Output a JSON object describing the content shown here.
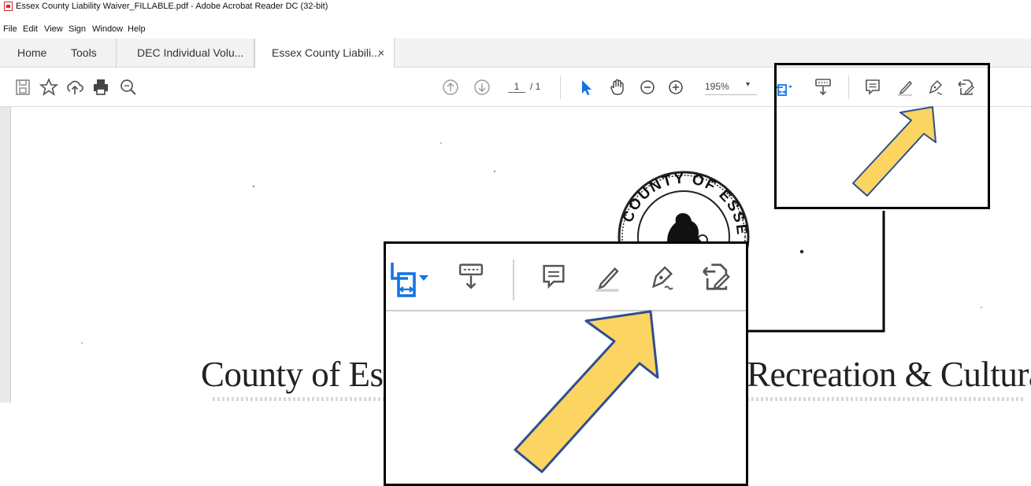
{
  "window": {
    "title": "Essex County Liability Waiver_FILLABLE.pdf - Adobe Acrobat Reader DC (32-bit)"
  },
  "menu": [
    "File",
    "Edit",
    "View",
    "Sign",
    "Window",
    "Help"
  ],
  "tabs": {
    "home": "Home",
    "tools": "Tools",
    "doc1": "DEC Individual Volu...",
    "doc2": "Essex County Liabili...",
    "close_glyph": "×"
  },
  "toolbar": {
    "page_current": "1",
    "page_total": "/ 1",
    "zoom": "195%",
    "zoom_caret": "▾"
  },
  "document": {
    "heading_left": "County of Es",
    "heading_right": "Recreation & Cultura",
    "seal_text": "COUNTY OF ESSEX"
  },
  "icons": {
    "toolbar_left": [
      "save-icon",
      "bookmark-star-icon",
      "cloud-upload-icon",
      "print-icon",
      "zoom-search-icon"
    ],
    "toolbar_nav": [
      "page-up-icon",
      "page-down-icon"
    ],
    "toolbar_view": [
      "select-cursor-icon",
      "hand-tool-icon",
      "zoom-out-icon",
      "zoom-in-icon"
    ],
    "toolbar_right": [
      "fit-width-icon",
      "scroll-mode-icon",
      "comment-icon",
      "highlight-pen-icon",
      "fill-sign-icon",
      "edit-form-icon"
    ]
  },
  "colors": {
    "accent_blue": "#1473e6",
    "arrow_fill": "#fcd462",
    "arrow_stroke": "#2e4f8f",
    "icon_gray": "#6e6e6e"
  }
}
